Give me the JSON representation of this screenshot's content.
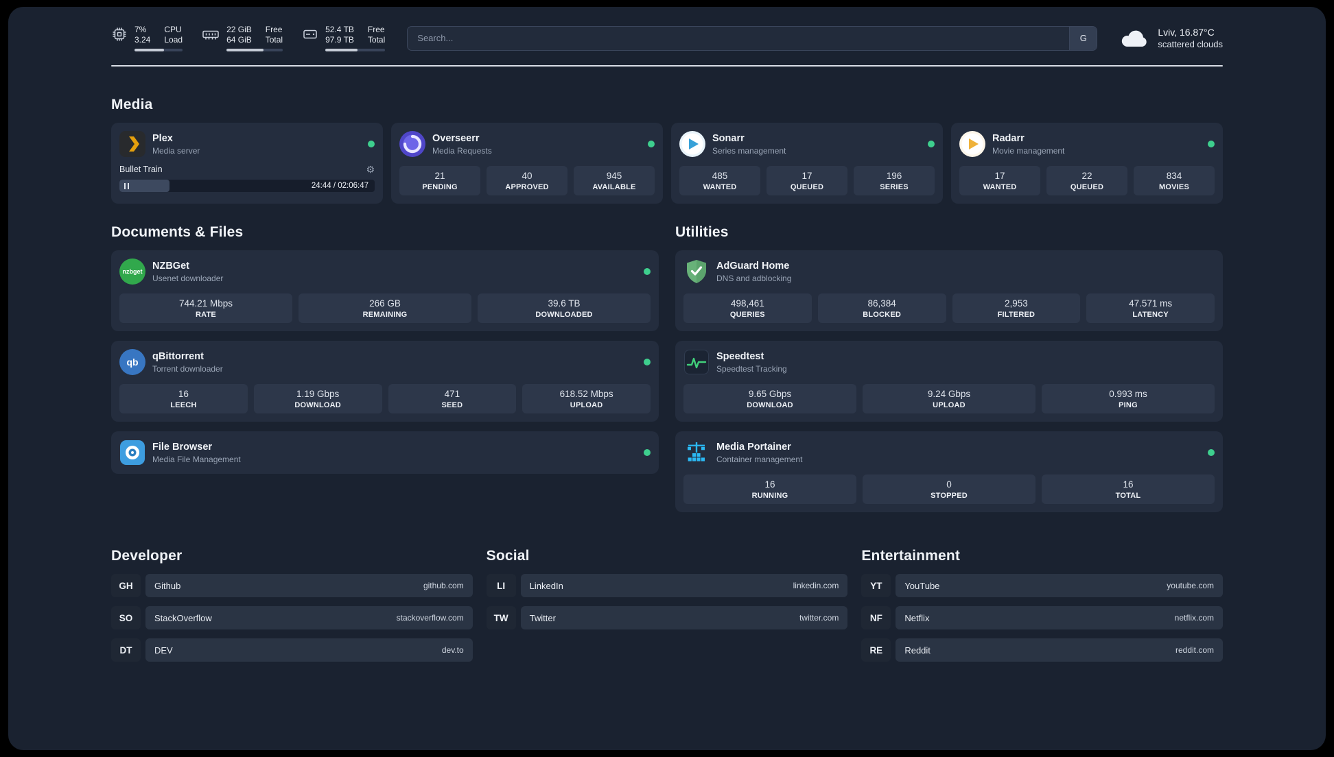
{
  "colors": {
    "app_background": "#1a2230",
    "card_background": "#242d3e",
    "tile_background": "#2d374a",
    "status_online": "#3ecf8e",
    "plex_accent": "#e5a00d",
    "portainer_blue": "#2bb9f4",
    "adguard_green": "#68b279"
  },
  "topbar": {
    "cpu": {
      "usage": "7%",
      "load": "3.24",
      "label_top": "CPU",
      "label_bottom": "Load",
      "bar_percent": 62
    },
    "memory": {
      "free": "22 GiB",
      "total": "64 GiB",
      "label_top": "Free",
      "label_bottom": "Total",
      "bar_percent": 66
    },
    "storage": {
      "free": "52.4 TB",
      "total": "97.9 TB",
      "label_top": "Free",
      "label_bottom": "Total",
      "bar_percent": 54
    },
    "search": {
      "placeholder": "Search...",
      "engine_button": "G"
    },
    "weather": {
      "location": "Lviv, 16.87°C",
      "condition": "scattered clouds"
    }
  },
  "media": {
    "title": "Media",
    "plex": {
      "name": "Plex",
      "subtitle": "Media server",
      "now_playing": "Bullet Train",
      "time": "24:44 / 02:06:47",
      "progress_percent": 19.5
    },
    "overseerr": {
      "name": "Overseerr",
      "subtitle": "Media Requests",
      "stats": [
        {
          "value": "21",
          "label": "PENDING"
        },
        {
          "value": "40",
          "label": "APPROVED"
        },
        {
          "value": "945",
          "label": "AVAILABLE"
        }
      ]
    },
    "sonarr": {
      "name": "Sonarr",
      "subtitle": "Series management",
      "stats": [
        {
          "value": "485",
          "label": "WANTED"
        },
        {
          "value": "17",
          "label": "QUEUED"
        },
        {
          "value": "196",
          "label": "SERIES"
        }
      ]
    },
    "radarr": {
      "name": "Radarr",
      "subtitle": "Movie management",
      "stats": [
        {
          "value": "17",
          "label": "WANTED"
        },
        {
          "value": "22",
          "label": "QUEUED"
        },
        {
          "value": "834",
          "label": "MOVIES"
        }
      ]
    }
  },
  "documents": {
    "title": "Documents & Files",
    "nzbget": {
      "name": "NZBGet",
      "subtitle": "Usenet downloader",
      "stats": [
        {
          "value": "744.21 Mbps",
          "label": "RATE"
        },
        {
          "value": "266 GB",
          "label": "REMAINING"
        },
        {
          "value": "39.6 TB",
          "label": "DOWNLOADED"
        }
      ]
    },
    "qbittorrent": {
      "name": "qBittorrent",
      "subtitle": "Torrent downloader",
      "stats": [
        {
          "value": "16",
          "label": "LEECH"
        },
        {
          "value": "1.19 Gbps",
          "label": "DOWNLOAD"
        },
        {
          "value": "471",
          "label": "SEED"
        },
        {
          "value": "618.52 Mbps",
          "label": "UPLOAD"
        }
      ]
    },
    "filebrowser": {
      "name": "File Browser",
      "subtitle": "Media File Management"
    }
  },
  "utilities": {
    "title": "Utilities",
    "adguard": {
      "name": "AdGuard Home",
      "subtitle": "DNS and adblocking",
      "stats": [
        {
          "value": "498,461",
          "label": "QUERIES"
        },
        {
          "value": "86,384",
          "label": "BLOCKED"
        },
        {
          "value": "2,953",
          "label": "FILTERED"
        },
        {
          "value": "47.571 ms",
          "label": "LATENCY"
        }
      ]
    },
    "speedtest": {
      "name": "Speedtest",
      "subtitle": "Speedtest Tracking",
      "stats": [
        {
          "value": "9.65 Gbps",
          "label": "DOWNLOAD"
        },
        {
          "value": "9.24 Gbps",
          "label": "UPLOAD"
        },
        {
          "value": "0.993 ms",
          "label": "PING"
        }
      ]
    },
    "portainer": {
      "name": "Media Portainer",
      "subtitle": "Container management",
      "stats": [
        {
          "value": "16",
          "label": "RUNNING"
        },
        {
          "value": "0",
          "label": "STOPPED"
        },
        {
          "value": "16",
          "label": "TOTAL"
        }
      ]
    }
  },
  "bookmarks": {
    "developer": {
      "title": "Developer",
      "items": [
        {
          "abbr": "GH",
          "name": "Github",
          "url": "github.com"
        },
        {
          "abbr": "SO",
          "name": "StackOverflow",
          "url": "stackoverflow.com"
        },
        {
          "abbr": "DT",
          "name": "DEV",
          "url": "dev.to"
        }
      ]
    },
    "social": {
      "title": "Social",
      "items": [
        {
          "abbr": "LI",
          "name": "LinkedIn",
          "url": "linkedin.com"
        },
        {
          "abbr": "TW",
          "name": "Twitter",
          "url": "twitter.com"
        }
      ]
    },
    "entertainment": {
      "title": "Entertainment",
      "items": [
        {
          "abbr": "YT",
          "name": "YouTube",
          "url": "youtube.com"
        },
        {
          "abbr": "NF",
          "name": "Netflix",
          "url": "netflix.com"
        },
        {
          "abbr": "RE",
          "name": "Reddit",
          "url": "reddit.com"
        }
      ]
    }
  }
}
